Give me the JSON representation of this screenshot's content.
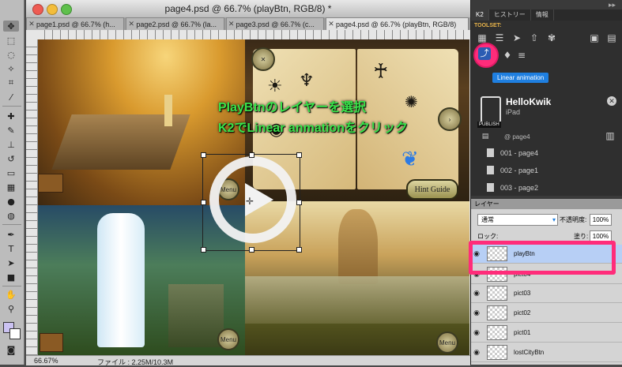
{
  "document": {
    "title": "page4.psd @ 66.7% (playBtn, RGB/8) *",
    "tabs": [
      {
        "label": "page1.psd @ 66.7% (h...",
        "active": false
      },
      {
        "label": "page2.psd @ 66.7% (la...",
        "active": false
      },
      {
        "label": "page3.psd @ 66.7% (c...",
        "active": false
      },
      {
        "label": "page4.psd @ 66.7% (playBtn, RGB/8)",
        "active": true
      }
    ],
    "zoom": "66.67%",
    "file_info": "ファイル : 2.25M/10.3M"
  },
  "canvas": {
    "overlay_line1": "PlayBtnのレイヤーを選択",
    "overlay_line2": "K2でLinear anmationをクリック",
    "hint_button": "Hint Guide",
    "menu_button": "Menu"
  },
  "k2_panel": {
    "tabs": [
      "K2",
      "ヒストリー",
      "情報"
    ],
    "toolset_label": "TOOLSET:",
    "tooltip": "Linear animation",
    "project_name": "HelloKwik",
    "device": "iPad",
    "publish_label": "PUBLISH",
    "current_page": "@ page4",
    "pages": [
      "001 - page4",
      "002 - page1",
      "003 - page2"
    ]
  },
  "layers_panel": {
    "tab": "レイヤー",
    "blend_mode": "通常",
    "opacity_label": "不透明度:",
    "opacity_value": "100%",
    "lock_label": "ロック:",
    "fill_label": "塗り:",
    "fill_value": "100%",
    "layers": [
      "playBtn",
      "pict04",
      "pict03",
      "pict02",
      "pict01",
      "lostCityBtn"
    ],
    "selected_layer": "playBtn"
  },
  "colors": {
    "highlight": "#ff2c7a",
    "overlay_text": "#39e34a",
    "tooltip_bg": "#1f7fe0",
    "foreground_swatch": "#cbc2f2"
  }
}
